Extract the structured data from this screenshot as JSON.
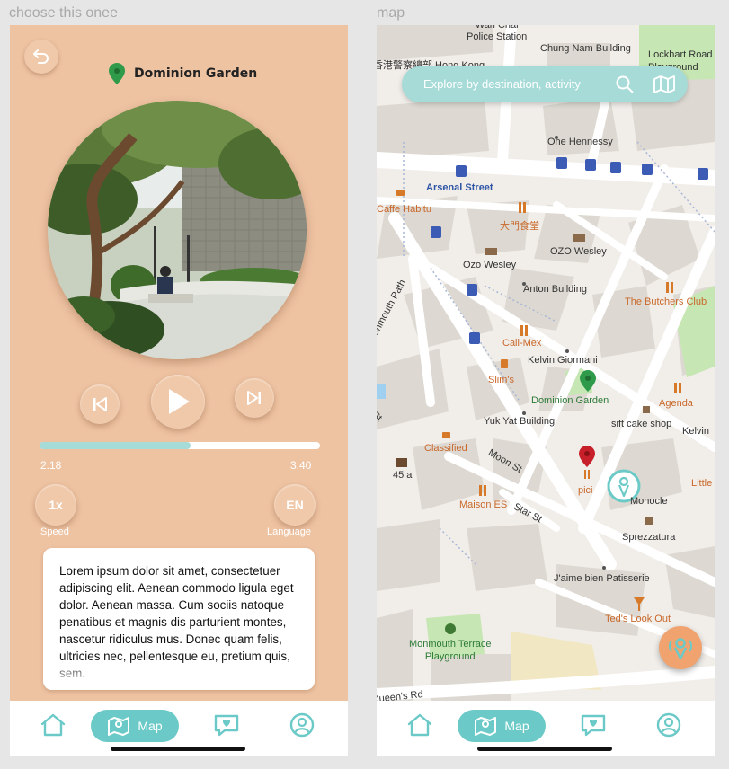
{
  "artboards": {
    "left_title": "choose this onee",
    "right_title": "map"
  },
  "player": {
    "place_name": "Dominion Garden",
    "time_current": "2.18",
    "time_total": "3.40",
    "progress_fraction": 0.54,
    "speed_value": "1x",
    "speed_label": "Speed",
    "language_value": "EN",
    "language_label": "Language",
    "description": "Lorem ipsum dolor sit amet, consectetuer adipiscing elit. Aenean commodo ligula eget dolor. Aenean massa. Cum sociis natoque penatibus et magnis dis parturient montes, nascetur ridiculus mus. Donec quam felis, ultricies nec, pellentesque eu, pretium quis, sem."
  },
  "nav": {
    "map_label": "Map"
  },
  "map": {
    "search_placeholder": "Explore by destination, activity",
    "labels": {
      "wan_chai_police": "Wan Chai\nPolice Station",
      "hk_police_hq": "香港警察總部 Hong Kong",
      "chung_nam": "Chung Nam Building",
      "lockhart": "Lockhart Road\nPlayground",
      "one_hennessy": "One Hennessy",
      "arsenal": "Arsenal Street",
      "caffe_habitu": "Caffe Habitu",
      "big_door": "大門食堂",
      "ozo_wesley_1": "Ozo Wesley",
      "ozo_wesley_2": "OZO Wesley",
      "anton": "Anton Building",
      "butchers": "The Butchers Club",
      "monmouth_path": "Monmouth Path",
      "cali_mex": "Cali-Mex",
      "kelvin_giormani": "Kelvin Giormani",
      "slims": "Slim's",
      "dominion_garden": "Dominion Garden",
      "agenda": "Agenda",
      "yuk_yat": "Yuk Yat Building",
      "sift": "sift cake shop",
      "kelvin": "Kelvin",
      "classified": "Classified",
      "moon_st": "Moon St",
      "45a": "45 a",
      "pici": "pici",
      "little": "Little",
      "maison": "Maison ES",
      "star_st": "Star St",
      "monocle": "Monocle",
      "sprezzatura": "Sprezzatura",
      "jaime": "J'aime bien Patisserie",
      "teds": "Ted's Look Out",
      "monmouth_terrace": "Monmouth Terrace\nPlayground",
      "queens_rd": "Queen's Rd",
      "st": "St"
    }
  },
  "colors": {
    "peach_bg": "#eec3a2",
    "teal": "#6bcac7",
    "teal_light": "#a6dbd8",
    "fab_orange": "#f0a36e"
  }
}
